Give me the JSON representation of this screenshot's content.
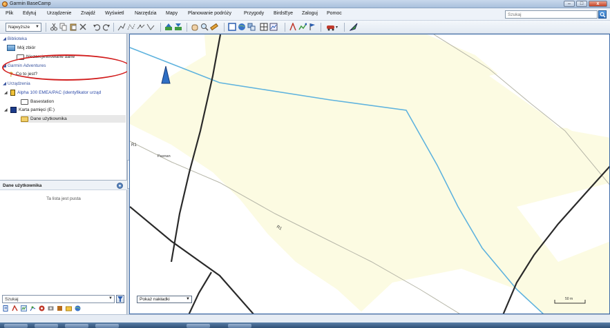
{
  "window": {
    "title": "Garmin BaseCamp",
    "controls": [
      "–",
      "□",
      "x"
    ]
  },
  "menu": {
    "items": [
      "Plik",
      "Edytuj",
      "Urządzenie",
      "Znajdź",
      "Wyświetl",
      "Narzędzia",
      "Mapy",
      "Planowanie podróży",
      "Przygody",
      "BirdsEye",
      "Zaloguj",
      "Pomoc"
    ],
    "search_placeholder": "Szukaj"
  },
  "toolbar": {
    "sort_combo": "Najwyższe",
    "icons": [
      "cut-icon",
      "copy-icon",
      "paste-icon",
      "delete-icon",
      "undo-icon",
      "redo-icon",
      "waypoint-tool-icon",
      "route-tool-icon",
      "track-tool-icon",
      "measure-tool-icon",
      "receive-from-device-icon",
      "send-to-device-icon",
      "hand-tool-icon",
      "zoom-tool-icon",
      "ruler-tool-icon",
      "map-2d-icon",
      "globe-icon",
      "layers-icon",
      "grid-icon",
      "profile-icon",
      "new-route-icon",
      "new-track-icon",
      "flag-icon",
      "car-profile-icon",
      "birdseye-icon"
    ]
  },
  "library": {
    "header": "Biblioteka",
    "my_collection": "Mój zbiór",
    "unlisted_data": "Niezarejestrowane dane"
  },
  "adventures": {
    "header": "Garmin Adventures",
    "what_is_it": "Co to jest?"
  },
  "devices": {
    "header": "Urządzenia",
    "device_name": "Alpha 100 EMEA/PAC (identyfikator urząd",
    "basestation": "Basestation",
    "memory_card": "Karta pamięci (E:)",
    "user_data": "Dane użytkownika"
  },
  "lower_panel": {
    "title": "Dane użytkownika",
    "empty_message": "Ta lista jest pusta",
    "filter_placeholder": "Szukaj"
  },
  "map": {
    "overlay_select": "Pokaż nakładki",
    "place_label": "Pasnan",
    "road_label_1": "R1",
    "road_label_2": "R1",
    "scale_label": "50 m"
  },
  "colors": {
    "land": "#fcfbe2",
    "river": "#5fb3de",
    "road_dark": "#2a2a2a",
    "road_light": "#b6b6a8",
    "highlight_oval": "#d21e1e",
    "device_text": "#2c4aa8"
  }
}
